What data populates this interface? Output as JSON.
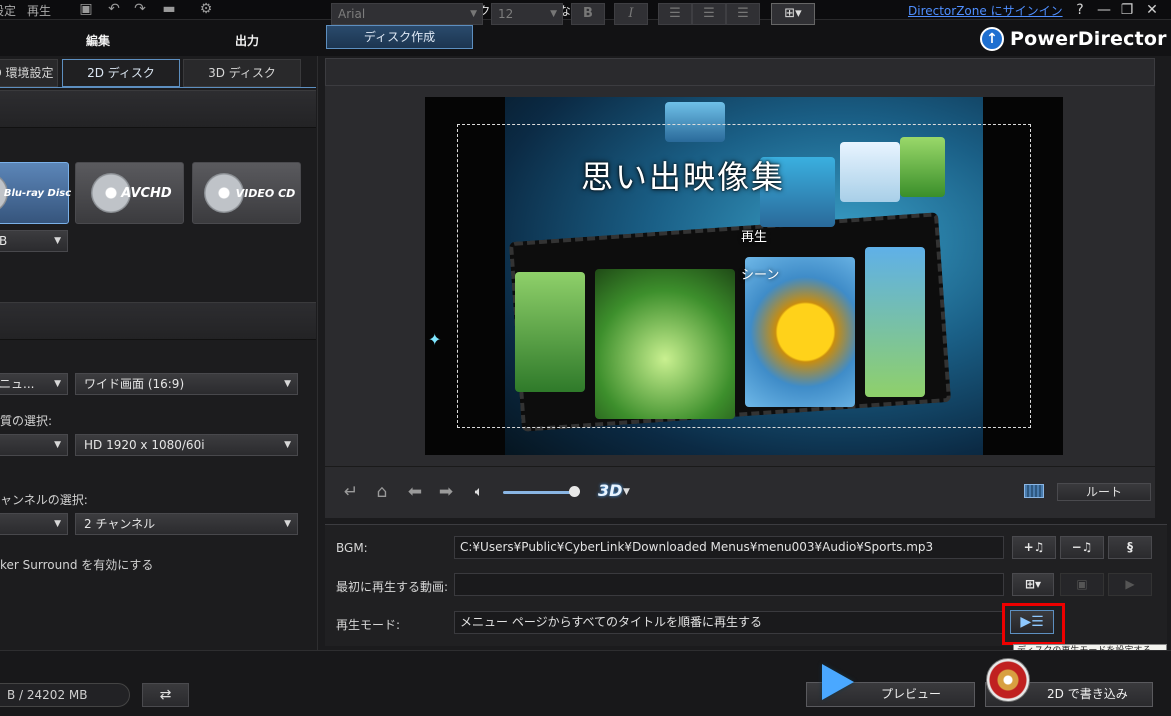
{
  "titlebar": {
    "menu_items": [
      "設定",
      "再生"
    ],
    "title": "新規プロジェクト (タイトルなし)*",
    "signin_link": "DirectorZone にサインイン",
    "help": "?",
    "minimize": "—",
    "restore": "❐",
    "close": "✕"
  },
  "header": {
    "tab_edit": "編集",
    "tab_output": "出力",
    "tab_disc_create": "ディスク作成",
    "brand": "PowerDirector"
  },
  "left": {
    "tabs": [
      "D 環境設定",
      "2D ディスク",
      "3D ディスク"
    ],
    "disc_types": [
      "Blu-ray Disc",
      "AVCHD",
      "VIDEO CD"
    ],
    "capacity_select": "B",
    "menu_select": "ニュ...",
    "aspect_select": "ワイド画面 (16:9)",
    "quality_label": "質の選択:",
    "resolution_select": "HD 1920 x 1080/60i",
    "channel_label": "ャンネルの選択:",
    "channel_select": "2 チャンネル",
    "surround_label": "ker Surround を有効にする"
  },
  "toolbar": {
    "font": "Arial",
    "size": "12",
    "bold": "B",
    "italic": "I"
  },
  "preview": {
    "menu_title": "思い出映像集",
    "play_button": "再生",
    "scenes_button": "シーン"
  },
  "playback": {
    "three_d": "3D",
    "root_button": "ルート"
  },
  "settings": {
    "bgm_label": "BGM:",
    "bgm_path": "C:¥Users¥Public¥CyberLink¥Downloaded Menus¥menu003¥Audio¥Sports.mp3",
    "first_play_label": "最初に再生する動画:",
    "first_play_value": "",
    "play_mode_label": "再生モード:",
    "play_mode_value": "メニュー ページからすべてのタイトルを順番に再生する",
    "tooltip": "ディスクの再生モードを設定する"
  },
  "bottom": {
    "space": "B / 24202 MB",
    "preview_button": "プレビュー",
    "burn_button": "2D で書き込み"
  },
  "colors": {
    "accent": "#5d8fc0",
    "highlight": "#ee0000",
    "link": "#4f8fff"
  }
}
